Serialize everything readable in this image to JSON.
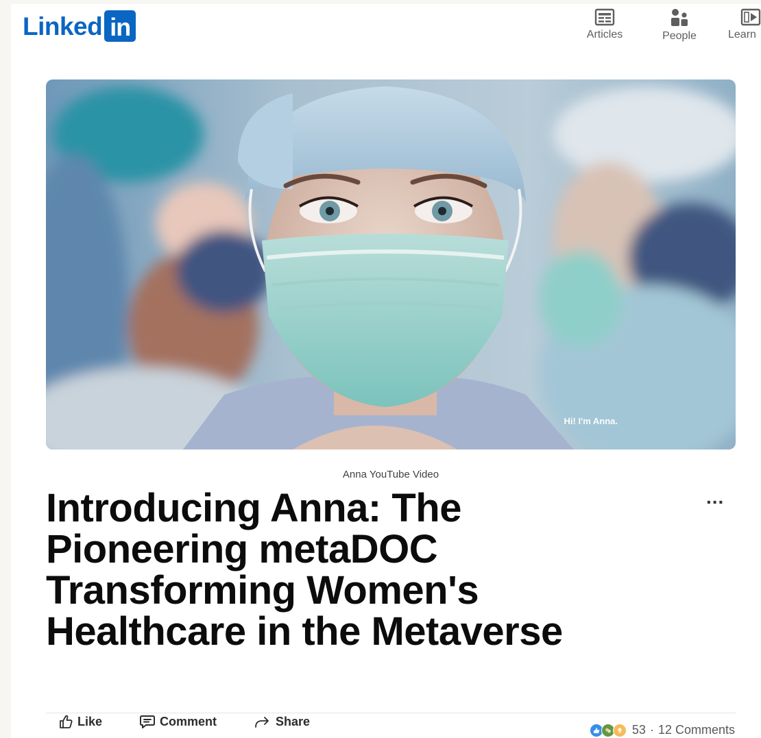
{
  "header": {
    "logo_text": "Linked",
    "logo_box_text": "in",
    "nav": [
      {
        "label": "Articles",
        "icon": "articles-icon"
      },
      {
        "label": "People",
        "icon": "people-icon"
      },
      {
        "label": "Learn",
        "icon": "learning-icon"
      }
    ]
  },
  "hero": {
    "caption": "Hi! I'm Anna."
  },
  "article": {
    "kicker": "Anna YouTube Video",
    "title": "Introducing Anna: The Pioneering metaDOC Transforming Women's Healthcare in the Metaverse",
    "more": "..."
  },
  "actions": {
    "like": "Like",
    "comment": "Comment",
    "share": "Share"
  },
  "social": {
    "reactions": [
      "like-reaction-icon",
      "celebrate-reaction-icon",
      "insightful-reaction-icon"
    ],
    "count": "53",
    "separator": "·",
    "comments": "12 Comments"
  },
  "colors": {
    "brand": "#0a66c2",
    "text_primary": "#0c0c0c",
    "text_secondary": "#5e5e5e"
  }
}
